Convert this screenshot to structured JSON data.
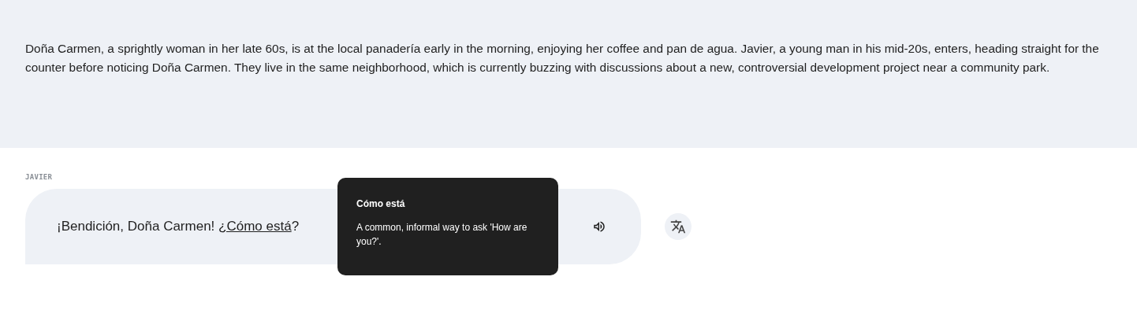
{
  "scenario": {
    "text": "Doña Carmen, a sprightly woman in her late 60s, is at the local panadería early in the morning, enjoying her coffee and pan de agua. Javier, a young man in his mid-20s, enters, heading straight for the counter before noticing Doña Carmen. They live in the same neighborhood, which is currently buzzing with discussions about a new, controversial development project near a community park."
  },
  "messages": [
    {
      "speaker": "JAVIER",
      "segments": [
        {
          "kind": "plain",
          "text": "¡Bendición, Doña Carmen! "
        },
        {
          "kind": "term",
          "text": "¿Cómo está"
        },
        {
          "kind": "plain",
          "text": "?"
        }
      ],
      "tooltip": {
        "title": "Cómo está",
        "body": "A common, informal way to ask 'How are you?'."
      }
    }
  ]
}
